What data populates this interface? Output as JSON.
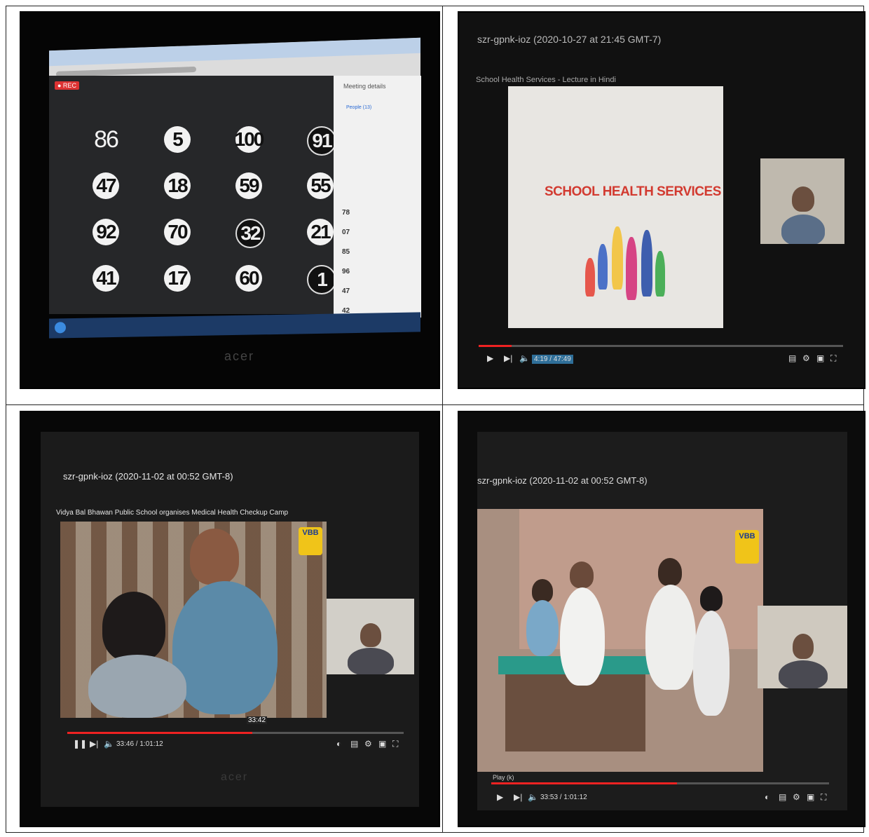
{
  "panels": {
    "top_left": {
      "rec_badge": "● REC",
      "meeting_details": "Meeting details",
      "people_tab": "People (13)",
      "participant_numbers": [
        "86",
        "5",
        "100",
        "91",
        "47",
        "18",
        "59",
        "55",
        "92",
        "70",
        "32",
        "21",
        "41",
        "17",
        "60",
        "1"
      ],
      "sidebar_numbers": [
        "78",
        "07",
        "85",
        "96",
        "47",
        "42"
      ],
      "monitor_brand": "acer"
    },
    "top_right": {
      "title": "szr-gpnk-ioz (2020-10-27 at 21:45 GMT-7)",
      "subtitle": "School Health Services - Lecture in Hindi",
      "slide_text": "SCHOOL HEALTH SERVICES",
      "time": "4:19 / 47:49",
      "progress": 0.09
    },
    "bottom_left": {
      "title": "szr-gpnk-ioz (2020-11-02 at 00:52 GMT-8)",
      "subtitle": "Vidya Bal Bhawan Public School organises Medical Health Checkup Camp",
      "logo": "VBB",
      "hover_time": "33:42",
      "time": "33:46 / 1:01:12",
      "progress": 0.55,
      "monitor_brand": "acer"
    },
    "bottom_right": {
      "title": "szr-gpnk-ioz (2020-11-02 at 00:52 GMT-8)",
      "logo": "VBB",
      "play_tooltip": "Play (k)",
      "time": "33:53 / 1:01:12",
      "progress": 0.55
    }
  },
  "colors": {
    "progress_red": "#e22222",
    "screen_dark": "#1b1b1b",
    "slide_text": "#d23a30"
  }
}
